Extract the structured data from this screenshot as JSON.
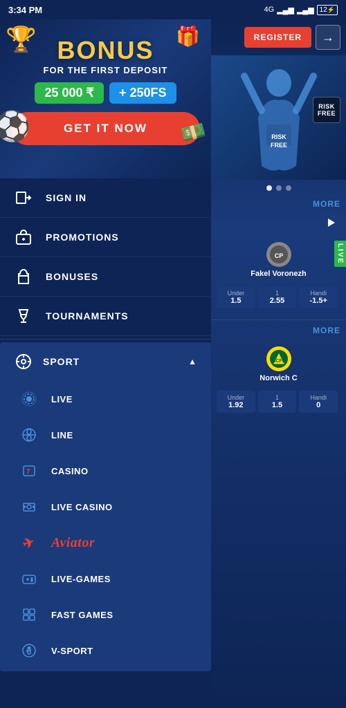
{
  "statusBar": {
    "time": "3:34 PM",
    "network": "4G",
    "battery": "12"
  },
  "header": {
    "registerLabel": "REGISTER",
    "loginArrow": "→"
  },
  "banner": {
    "title": "BONUS",
    "subtitle": "FOR THE FIRST DEPOSIT",
    "amount1": "25 000 ₹",
    "amount2": "+ 250FS",
    "ctaLabel": "GET IT NOW"
  },
  "sidebar": {
    "navItems": [
      {
        "id": "sign-in",
        "label": "SIGN IN",
        "icon": "⬛"
      },
      {
        "id": "promotions",
        "label": "PROMOTIONS",
        "icon": "🎁"
      },
      {
        "id": "bonuses",
        "label": "BONUSES",
        "icon": "💰"
      },
      {
        "id": "tournaments",
        "label": "TOURNAMENTS",
        "icon": "🏆"
      }
    ],
    "sportSection": {
      "label": "SPORT",
      "subItems": [
        {
          "id": "live",
          "label": "LIVE",
          "icon": "📡"
        },
        {
          "id": "line",
          "label": "LINE",
          "icon": "⚽"
        },
        {
          "id": "casino",
          "label": "CASINO",
          "icon": "7️⃣"
        },
        {
          "id": "live-casino",
          "label": "LIVE CASINO",
          "icon": "🃏"
        },
        {
          "id": "aviator",
          "label": "Aviator",
          "isAviator": true
        },
        {
          "id": "live-games",
          "label": "LIVE-GAMES",
          "icon": "🎮"
        },
        {
          "id": "fast-games",
          "label": "FAST GAMES",
          "icon": "🎲"
        },
        {
          "id": "v-sport",
          "label": "V-SPORT",
          "icon": "🥽"
        }
      ]
    }
  },
  "rightPanel": {
    "riskFreeLabel": "RISK\nFREE",
    "dots": [
      true,
      false,
      false
    ],
    "moreLabel": "MORE",
    "match1": {
      "teamName": "Fakel Voronezh",
      "teamIcon": "CP",
      "odds": [
        {
          "label": "Under",
          "value": "1.5"
        },
        {
          "label": "1",
          "value": "2.55"
        },
        {
          "label": "Handi",
          "value": "-1.5+"
        }
      ]
    },
    "more2Label": "MORE",
    "match2": {
      "teamName": "Norwich C",
      "teamIcon": "🦜",
      "odds": [
        {
          "label": "Under",
          "value": "1.92"
        },
        {
          "label": "1",
          "value": "1.5"
        },
        {
          "label": "Handi",
          "value": "0"
        }
      ]
    }
  }
}
